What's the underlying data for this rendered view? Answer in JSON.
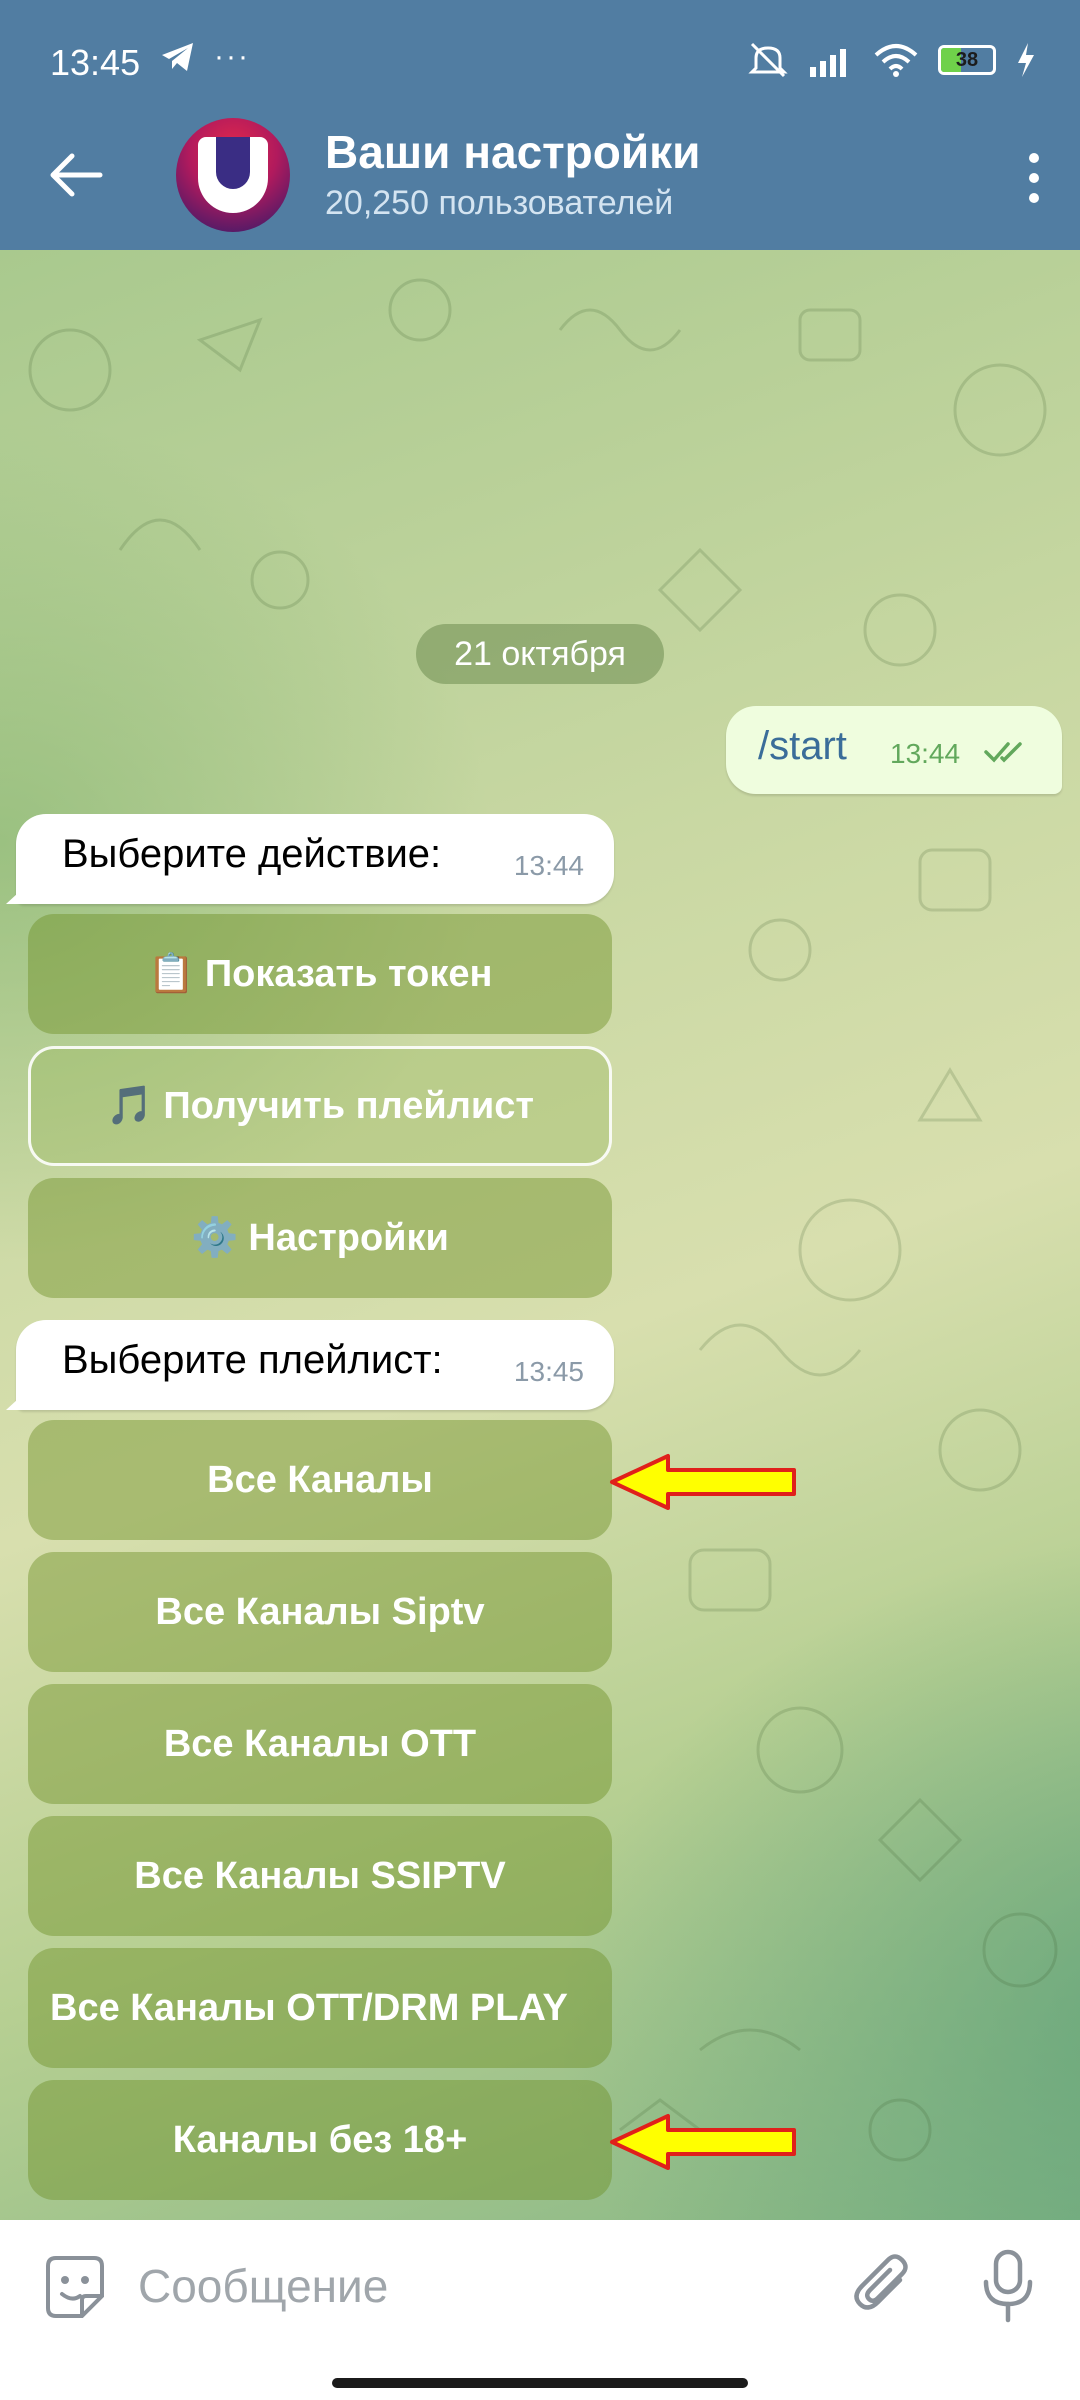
{
  "status_bar": {
    "time": "13:45",
    "extra": "···",
    "battery": "38",
    "battery_level": 0.38
  },
  "header": {
    "title": "Ваши настройки",
    "subtitle": "20,250 пользователей",
    "avatar_letter": "U"
  },
  "chat": {
    "date_chip": "21 октября",
    "outgoing": {
      "text": "/start",
      "time": "13:44"
    },
    "message1": {
      "text": "Выберите действие:",
      "time": "13:44"
    },
    "keyboard1": [
      {
        "icon": "📋",
        "label": "Показать токен"
      },
      {
        "icon": "🎵",
        "label": "Получить плейлист"
      },
      {
        "icon": "⚙️",
        "label": "Настройки"
      }
    ],
    "message2": {
      "text": "Выберите плейлист:",
      "time": "13:45"
    },
    "keyboard2": [
      {
        "label": "Все Каналы"
      },
      {
        "label": "Все Каналы Siptv"
      },
      {
        "label": "Все Каналы OTT"
      },
      {
        "label": "Все Каналы SSIPTV"
      },
      {
        "label": "Все Каналы OTT/DRM PLAY"
      },
      {
        "label": "Каналы без 18+"
      }
    ]
  },
  "input": {
    "placeholder": "Сообщение",
    "value": ""
  },
  "colors": {
    "header": "#517da2",
    "outgoing_bubble": "#effdde",
    "arrow_fill": "#ffff00",
    "arrow_stroke": "#e0201b"
  }
}
